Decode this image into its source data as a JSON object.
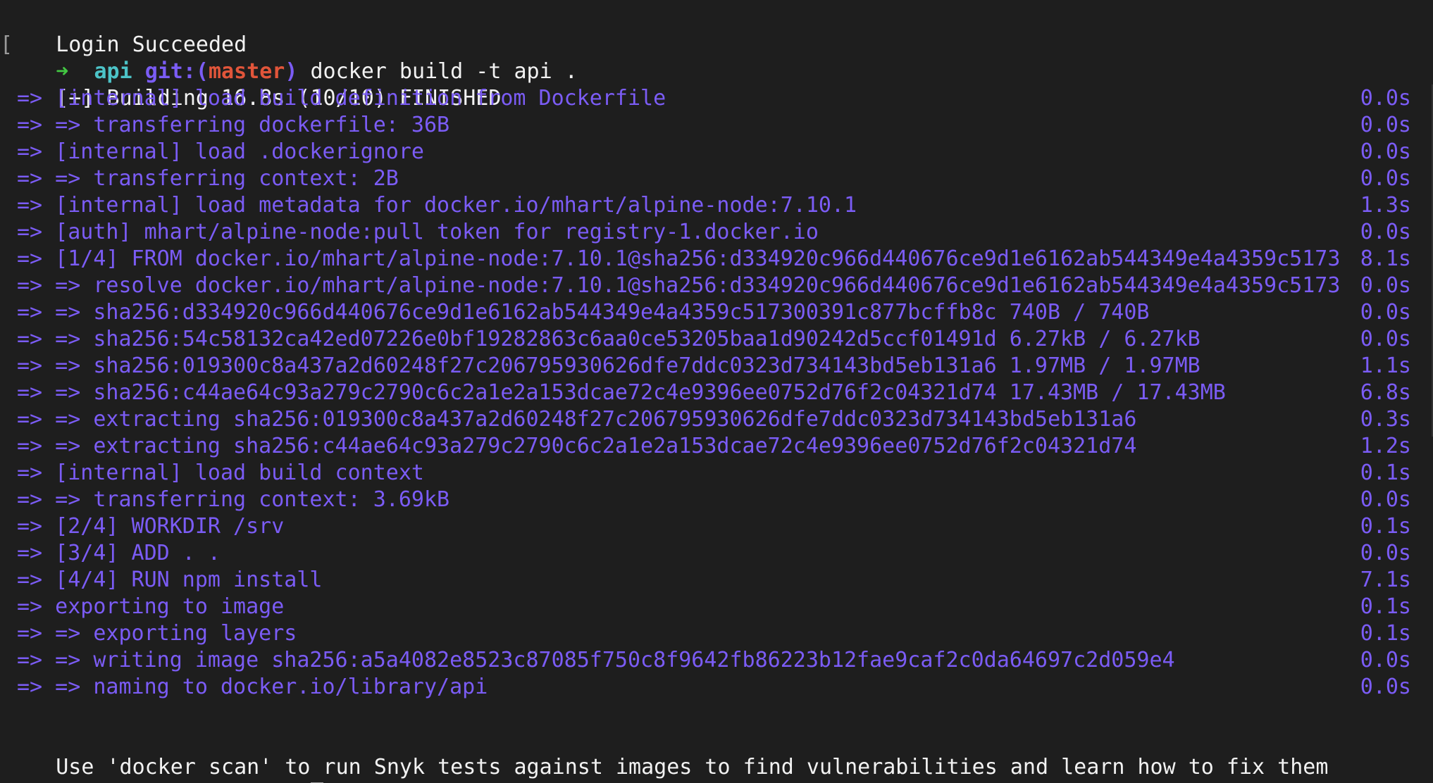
{
  "login_message": "Login Succeeded",
  "prompt": {
    "arrow": "➜",
    "dir": "api",
    "git_prefix": "git:(",
    "branch": "master",
    "git_suffix": ")"
  },
  "command": "docker build -t api .",
  "build_header": "[+] Building 16.8s (10/10) FINISHED",
  "steps": [
    {
      "text": "=> [internal] load build definition from Dockerfile",
      "time": "0.0s"
    },
    {
      "text": "=> => transferring dockerfile: 36B",
      "time": "0.0s"
    },
    {
      "text": "=> [internal] load .dockerignore",
      "time": "0.0s"
    },
    {
      "text": "=> => transferring context: 2B",
      "time": "0.0s"
    },
    {
      "text": "=> [internal] load metadata for docker.io/mhart/alpine-node:7.10.1",
      "time": "1.3s"
    },
    {
      "text": "=> [auth] mhart/alpine-node:pull token for registry-1.docker.io",
      "time": "0.0s"
    },
    {
      "text": "=> [1/4] FROM docker.io/mhart/alpine-node:7.10.1@sha256:d334920c966d440676ce9d1e6162ab544349e4a4359c5173",
      "time": "8.1s"
    },
    {
      "text": "=> => resolve docker.io/mhart/alpine-node:7.10.1@sha256:d334920c966d440676ce9d1e6162ab544349e4a4359c5173",
      "time": "0.0s"
    },
    {
      "text": "=> => sha256:d334920c966d440676ce9d1e6162ab544349e4a4359c517300391c877bcffb8c 740B / 740B",
      "time": "0.0s"
    },
    {
      "text": "=> => sha256:54c58132ca42ed07226e0bf19282863c6aa0ce53205baa1d90242d5ccf01491d 6.27kB / 6.27kB",
      "time": "0.0s"
    },
    {
      "text": "=> => sha256:019300c8a437a2d60248f27c206795930626dfe7ddc0323d734143bd5eb131a6 1.97MB / 1.97MB",
      "time": "1.1s"
    },
    {
      "text": "=> => sha256:c44ae64c93a279c2790c6c2a1e2a153dcae72c4e9396ee0752d76f2c04321d74 17.43MB / 17.43MB",
      "time": "6.8s"
    },
    {
      "text": "=> => extracting sha256:019300c8a437a2d60248f27c206795930626dfe7ddc0323d734143bd5eb131a6",
      "time": "0.3s"
    },
    {
      "text": "=> => extracting sha256:c44ae64c93a279c2790c6c2a1e2a153dcae72c4e9396ee0752d76f2c04321d74",
      "time": "1.2s"
    },
    {
      "text": "=> [internal] load build context",
      "time": "0.1s"
    },
    {
      "text": "=> => transferring context: 3.69kB",
      "time": "0.0s"
    },
    {
      "text": "=> [2/4] WORKDIR /srv",
      "time": "0.1s"
    },
    {
      "text": "=> [3/4] ADD . .",
      "time": "0.0s"
    },
    {
      "text": "=> [4/4] RUN npm install",
      "time": "7.1s"
    },
    {
      "text": "=> exporting to image",
      "time": "0.1s"
    },
    {
      "text": "=> => exporting layers",
      "time": "0.1s"
    },
    {
      "text": "=> => writing image sha256:a5a4082e8523c87085f750c8f9642fb86223b12fae9caf2c0da64697c2d059e4",
      "time": "0.0s"
    },
    {
      "text": "=> => naming to docker.io/library/api",
      "time": "0.0s"
    }
  ],
  "scan_hint": "Use 'docker scan' to run Snyk tests against images to find vulnerabilities and learn how to fix them",
  "colors": {
    "background": "#1e1e1e",
    "foreground": "#f2f2f2",
    "step": "#7b5cf5",
    "arrow": "#42c742",
    "dir": "#4cc3c7",
    "branch": "#e1553a"
  }
}
